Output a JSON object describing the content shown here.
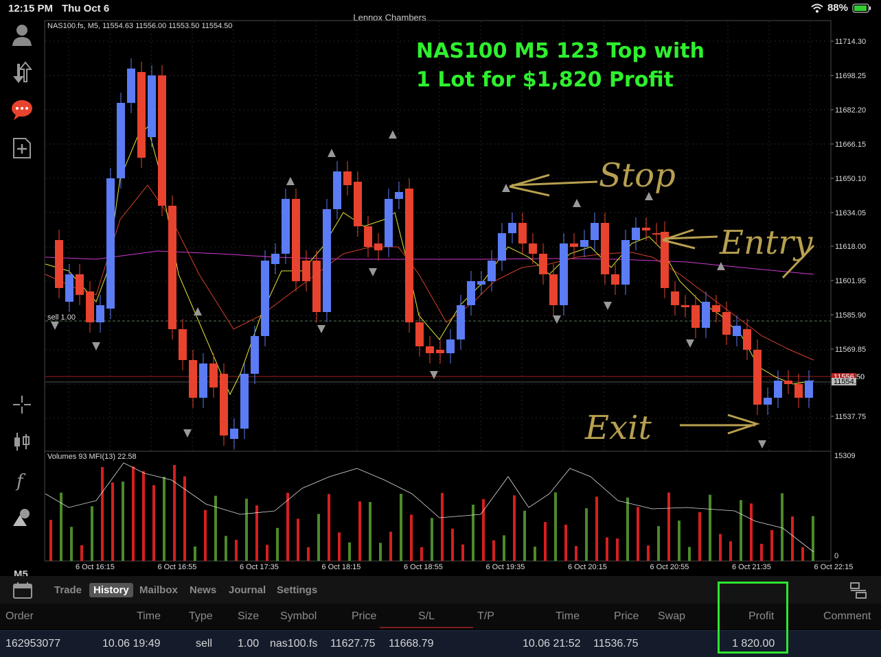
{
  "statusbar": {
    "time": "12:15 PM",
    "date": "Thu Oct 6",
    "battery": "88%"
  },
  "window_title": "Lennox Chambers",
  "chart": {
    "info": "NAS100.fs, M5, 11554.63 11556.00 11553.50 11554.50",
    "sell_label": "sell 1.00",
    "price_labels": [
      "11714.30",
      "11698.25",
      "11682.20",
      "11666.15",
      "11650.10",
      "11634.05",
      "11618.00",
      "11601.95",
      "11585.90",
      "11569.85",
      "11537.75"
    ],
    "bid_tag": "11556.50",
    "ask_tag": "11554.50",
    "volume_info": "Volumes 93 MFI(13) 22.58",
    "volume_max": "15309",
    "volume_min": "0",
    "time_labels": [
      "6 Oct 16:15",
      "6 Oct 16:55",
      "6 Oct 17:35",
      "6 Oct 18:15",
      "6 Oct 18:55",
      "6 Oct 19:35",
      "6 Oct 20:15",
      "6 Oct 20:55",
      "6 Oct 21:35",
      "6 Oct 22:15"
    ],
    "colors": {
      "bull": "#5b7cf5",
      "bear": "#e8432e",
      "vol_up": "#4c8a2a",
      "vol_down": "#d61f1f",
      "ma_fast": "#e6e63a",
      "ma_slow": "#d8402c",
      "ma_long": "#d23ad2"
    }
  },
  "annotation": {
    "line1": "NAS100 M5 123 Top with",
    "line2": "1 Lot for $1,820 Profit",
    "stop": "Stop",
    "entry": "Entry",
    "exit": "Exit"
  },
  "sidebar": {
    "timeframe": "M5"
  },
  "tabs": [
    "Trade",
    "History",
    "Mailbox",
    "News",
    "Journal",
    "Settings"
  ],
  "active_tab": "History",
  "table": {
    "headers": {
      "order": "Order",
      "time1": "Time",
      "type": "Type",
      "size": "Size",
      "symbol": "Symbol",
      "price1": "Price",
      "sl": "S/L",
      "tp": "T/P",
      "time2": "Time",
      "price2": "Price",
      "swap": "Swap",
      "profit": "Profit",
      "comment": "Comment"
    },
    "row": {
      "order": "162953077",
      "time1": "10.06 19:49",
      "type": "sell",
      "size": "1.00",
      "symbol": "nas100.fs",
      "price1": "11627.75",
      "sl": "11668.79",
      "tp": "",
      "time2": "10.06 21:52",
      "price2": "11536.75",
      "swap": "",
      "profit": "1 820.00",
      "comment": ""
    }
  }
}
